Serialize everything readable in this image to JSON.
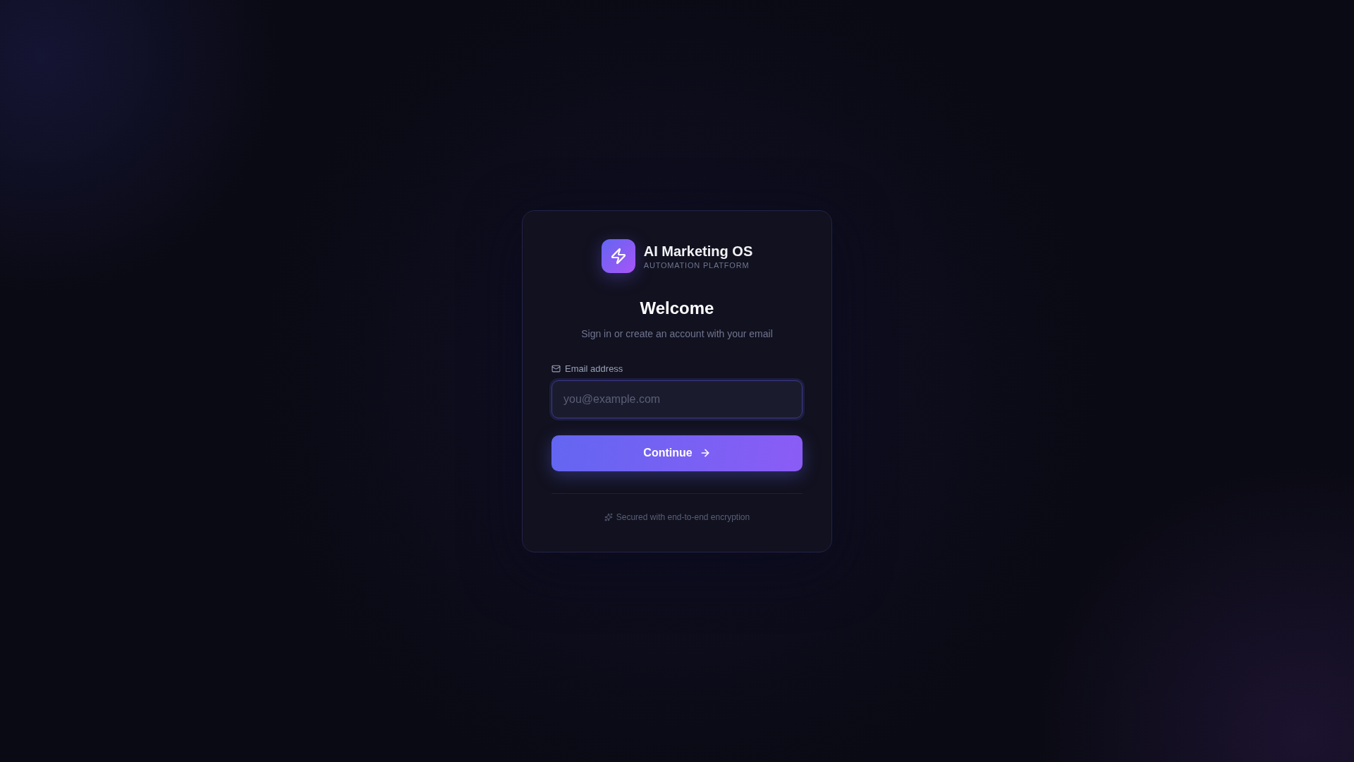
{
  "brand": {
    "name": "AI Marketing OS",
    "tagline": "AUTOMATION PLATFORM"
  },
  "heading": "Welcome",
  "subtitle": "Sign in or create an account with your email",
  "email_field": {
    "label": "Email address",
    "placeholder": "you@example.com"
  },
  "continue_button": {
    "label": "Continue"
  },
  "footer": "Secured with end-to-end encryption"
}
